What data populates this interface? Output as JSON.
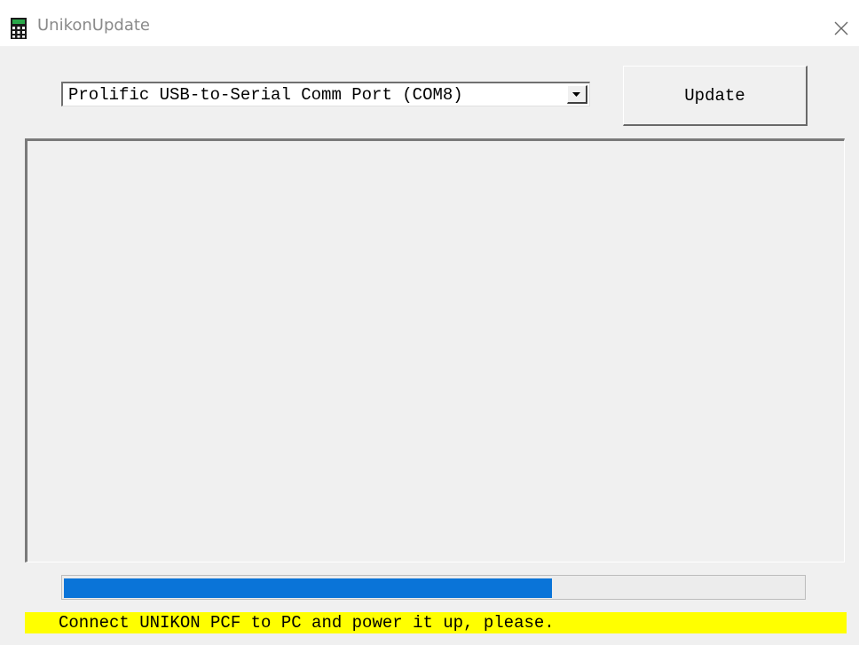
{
  "window": {
    "title": "UnikonUpdate",
    "icon": "calculator-icon",
    "close_icon": "close-icon"
  },
  "port_select": {
    "selected_value": "Prolific USB-to-Serial Comm Port (COM8)",
    "dropdown_icon": "chevron-down-icon"
  },
  "update_button": {
    "label": "Update"
  },
  "progress": {
    "fraction": 0.66,
    "color": "#0a74d8"
  },
  "status": {
    "message": "Connect UNIKON PCF to PC and power it up, please.",
    "background": "#ffff00"
  }
}
